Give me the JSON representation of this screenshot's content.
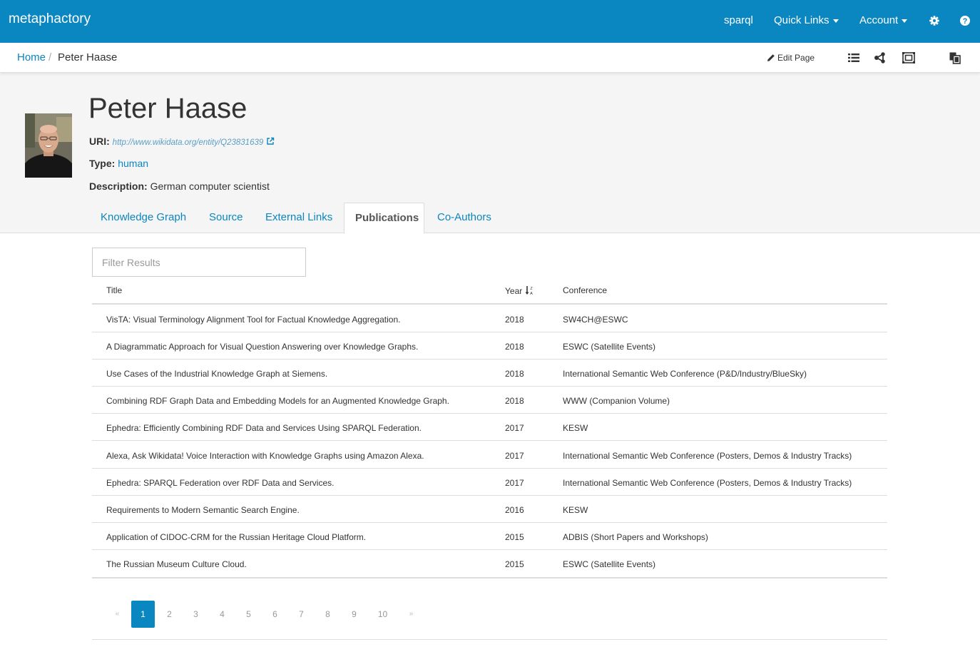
{
  "brand": "metaphactory",
  "nav": {
    "sparql": "sparql",
    "quick_links": "Quick Links",
    "account": "Account",
    "settings_icon": "gear-icon",
    "help_icon": "help-icon"
  },
  "breadcrumb": {
    "home": "Home",
    "separator": "/",
    "current": "Peter Haase"
  },
  "toolbar": {
    "edit_page": "Edit Page",
    "icons": [
      "list-icon",
      "share-graph-icon",
      "frame-icon",
      "copy-icon"
    ]
  },
  "entity": {
    "name": "Peter Haase",
    "uri_label": "URI:",
    "uri": "http://www.wikidata.org/entity/Q23831639",
    "type_label": "Type:",
    "type": "human",
    "description_label": "Description:",
    "description": "German computer scientist"
  },
  "tabs": [
    "Knowledge Graph",
    "Source",
    "External Links",
    "Publications",
    "Co-Authors"
  ],
  "active_tab": "Publications",
  "filter": {
    "placeholder": "Filter Results"
  },
  "table": {
    "columns": [
      "Title",
      "Year",
      "Conference"
    ],
    "sort_icon": "sort-alpha-icon",
    "rows": [
      {
        "title": "VisTA: Visual Terminology Alignment Tool for Factual Knowledge Aggregation.",
        "year": "2018",
        "conference": "SW4CH@ESWC"
      },
      {
        "title": "A Diagrammatic Approach for Visual Question Answering over Knowledge Graphs.",
        "year": "2018",
        "conference": "ESWC (Satellite Events)"
      },
      {
        "title": "Use Cases of the Industrial Knowledge Graph at Siemens.",
        "year": "2018",
        "conference": "International Semantic Web Conference (P&D/Industry/BlueSky)"
      },
      {
        "title": "Combining RDF Graph Data and Embedding Models for an Augmented Knowledge Graph.",
        "year": "2018",
        "conference": "WWW (Companion Volume)"
      },
      {
        "title": "Ephedra: Efficiently Combining RDF Data and Services Using SPARQL Federation.",
        "year": "2017",
        "conference": "KESW"
      },
      {
        "title": "Alexa, Ask Wikidata! Voice Interaction with Knowledge Graphs using Amazon Alexa.",
        "year": "2017",
        "conference": "International Semantic Web Conference (Posters, Demos & Industry Tracks)"
      },
      {
        "title": "Ephedra: SPARQL Federation over RDF Data and Services.",
        "year": "2017",
        "conference": "International Semantic Web Conference (Posters, Demos & Industry Tracks)"
      },
      {
        "title": "Requirements to Modern Semantic Search Engine.",
        "year": "2016",
        "conference": "KESW"
      },
      {
        "title": "Application of CIDOC-CRM for the Russian Heritage Cloud Platform.",
        "year": "2015",
        "conference": "ADBIS (Short Papers and Workshops)"
      },
      {
        "title": "The Russian Museum Culture Cloud.",
        "year": "2015",
        "conference": "ESWC (Satellite Events)"
      }
    ]
  },
  "pagination": {
    "prev": "«",
    "pages": [
      "1",
      "2",
      "3",
      "4",
      "5",
      "6",
      "7",
      "8",
      "9",
      "10"
    ],
    "next": "»",
    "current": "1"
  },
  "colors": {
    "primary": "#0a86c0",
    "header_bg": "#f5f5f5"
  }
}
